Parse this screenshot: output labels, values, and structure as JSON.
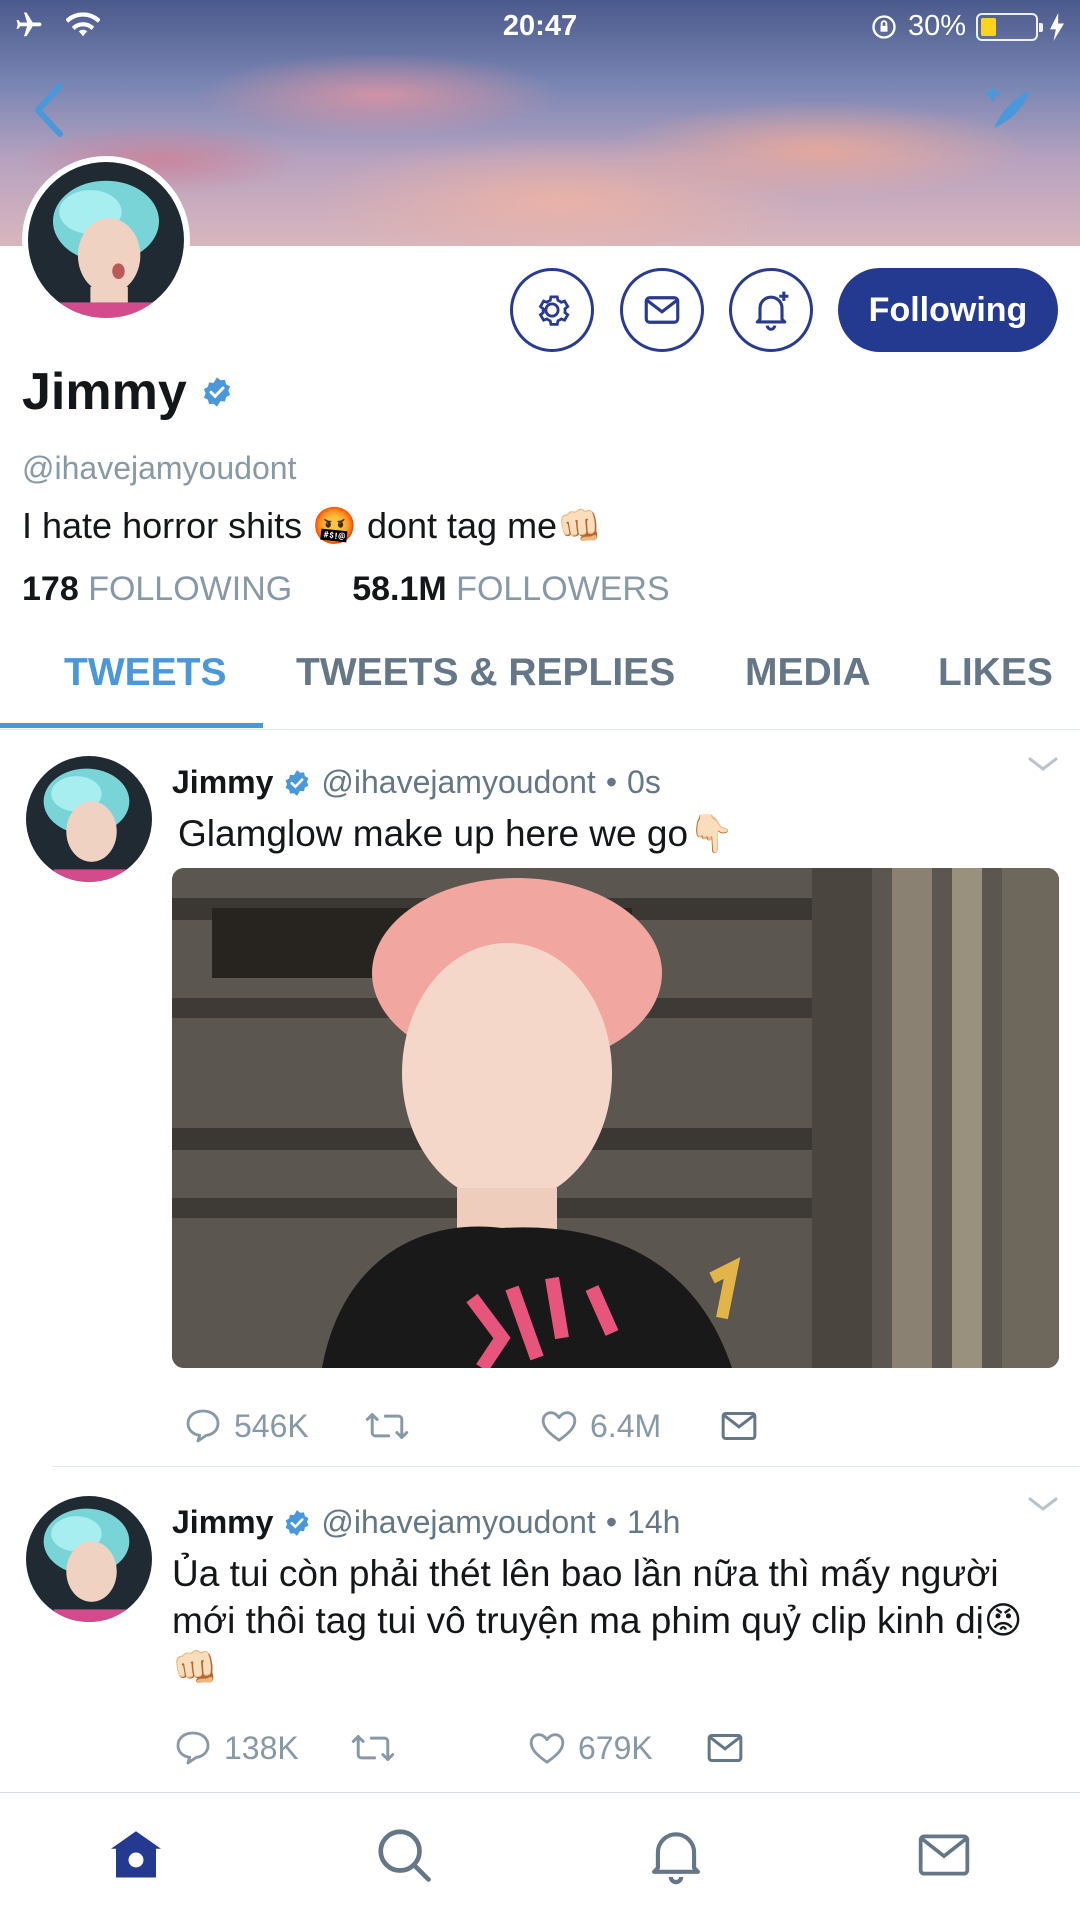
{
  "status_bar": {
    "time": "20:47",
    "battery_percent": "30%",
    "battery_level": 0.3,
    "icons": [
      "airplane-icon",
      "wifi-icon",
      "orientation-lock-icon",
      "battery-icon",
      "charging-icon"
    ]
  },
  "header": {
    "back_icon": "chevron-left-icon",
    "compose_icon": "compose-tweet-icon"
  },
  "profile": {
    "name": "Jimmy",
    "handle": "@ihavejamyoudont",
    "bio": "I hate horror shits 🤬 dont tag me👊🏻",
    "following_count": "178",
    "following_label": "FOLLOWING",
    "followers_count": "58.1M",
    "followers_label": "FOLLOWERS",
    "follow_button_label": "Following",
    "action_icons": [
      "gear-icon",
      "mail-icon",
      "bell-plus-icon"
    ]
  },
  "tabs": [
    {
      "label": "TWEETS",
      "active": true
    },
    {
      "label": "TWEETS & REPLIES",
      "active": false
    },
    {
      "label": "MEDIA",
      "active": false
    },
    {
      "label": "LIKES",
      "active": false
    }
  ],
  "tweets": [
    {
      "name": "Jimmy",
      "handle": "@ihavejamyoudont",
      "separator": "•",
      "time": "0s",
      "text": "Glamglow make up here we go👇🏻",
      "has_image": true,
      "replies": "546K",
      "retweets": "",
      "likes": "6.4M"
    },
    {
      "name": "Jimmy",
      "handle": "@ihavejamyoudont",
      "separator": "•",
      "time": "14h",
      "text": "Ủa tui còn phải thét lên bao lần nữa thì mấy người mới thôi tag tui vô truyện ma phim quỷ clip kinh dị😡👊🏻",
      "has_image": false,
      "replies": "138K",
      "retweets": "",
      "likes": "679K"
    }
  ],
  "bottom_nav": [
    {
      "icon": "home-icon",
      "active": true
    },
    {
      "icon": "search-icon",
      "active": false
    },
    {
      "icon": "notifications-icon",
      "active": false
    },
    {
      "icon": "messages-icon",
      "active": false
    }
  ],
  "colors": {
    "accent_blue": "#4a97d9",
    "button_navy": "#243a91",
    "muted_text": "#8899a6",
    "verified_blue": "#4a97d9"
  }
}
